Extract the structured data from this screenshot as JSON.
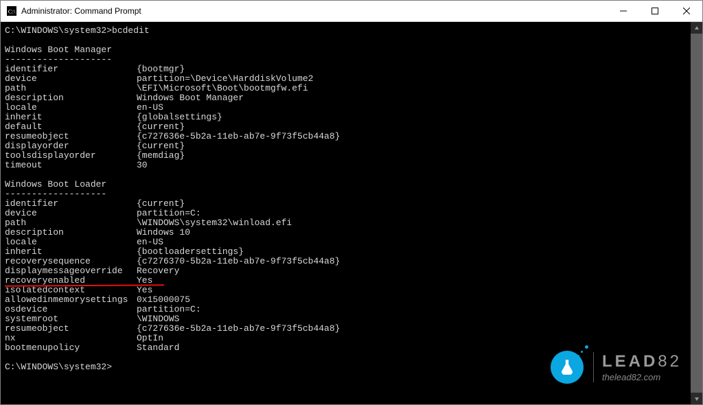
{
  "window": {
    "title": "Administrator: Command Prompt"
  },
  "terminal": {
    "prompt_path": "C:\\WINDOWS\\system32>",
    "command": "bcdedit",
    "sections": [
      {
        "title": "Windows Boot Manager",
        "dashes": "--------------------",
        "rows": [
          {
            "k": "identifier",
            "v": "{bootmgr}"
          },
          {
            "k": "device",
            "v": "partition=\\Device\\HarddiskVolume2"
          },
          {
            "k": "path",
            "v": "\\EFI\\Microsoft\\Boot\\bootmgfw.efi"
          },
          {
            "k": "description",
            "v": "Windows Boot Manager"
          },
          {
            "k": "locale",
            "v": "en-US"
          },
          {
            "k": "inherit",
            "v": "{globalsettings}"
          },
          {
            "k": "default",
            "v": "{current}"
          },
          {
            "k": "resumeobject",
            "v": "{c727636e-5b2a-11eb-ab7e-9f73f5cb44a8}"
          },
          {
            "k": "displayorder",
            "v": "{current}"
          },
          {
            "k": "toolsdisplayorder",
            "v": "{memdiag}"
          },
          {
            "k": "timeout",
            "v": "30"
          }
        ]
      },
      {
        "title": "Windows Boot Loader",
        "dashes": "-------------------",
        "rows": [
          {
            "k": "identifier",
            "v": "{current}"
          },
          {
            "k": "device",
            "v": "partition=C:"
          },
          {
            "k": "path",
            "v": "\\WINDOWS\\system32\\winload.efi"
          },
          {
            "k": "description",
            "v": "Windows 10"
          },
          {
            "k": "locale",
            "v": "en-US"
          },
          {
            "k": "inherit",
            "v": "{bootloadersettings}"
          },
          {
            "k": "recoverysequence",
            "v": "{c7276370-5b2a-11eb-ab7e-9f73f5cb44a8}"
          },
          {
            "k": "displaymessageoverride",
            "v": "Recovery"
          },
          {
            "k": "recoveryenabled",
            "v": "Yes",
            "highlight": true
          },
          {
            "k": "isolatedcontext",
            "v": "Yes"
          },
          {
            "k": "allowedinmemorysettings",
            "v": "0x15000075"
          },
          {
            "k": "osdevice",
            "v": "partition=C:"
          },
          {
            "k": "systemroot",
            "v": "\\WINDOWS"
          },
          {
            "k": "resumeobject",
            "v": "{c727636e-5b2a-11eb-ab7e-9f73f5cb44a8}"
          },
          {
            "k": "nx",
            "v": "OptIn"
          },
          {
            "k": "bootmenupolicy",
            "v": "Standard"
          }
        ]
      }
    ],
    "trailing_prompt": "C:\\WINDOWS\\system32>"
  },
  "watermark": {
    "brand_bold": "LEAD",
    "brand_light": "82",
    "site": "thelead82.com"
  }
}
